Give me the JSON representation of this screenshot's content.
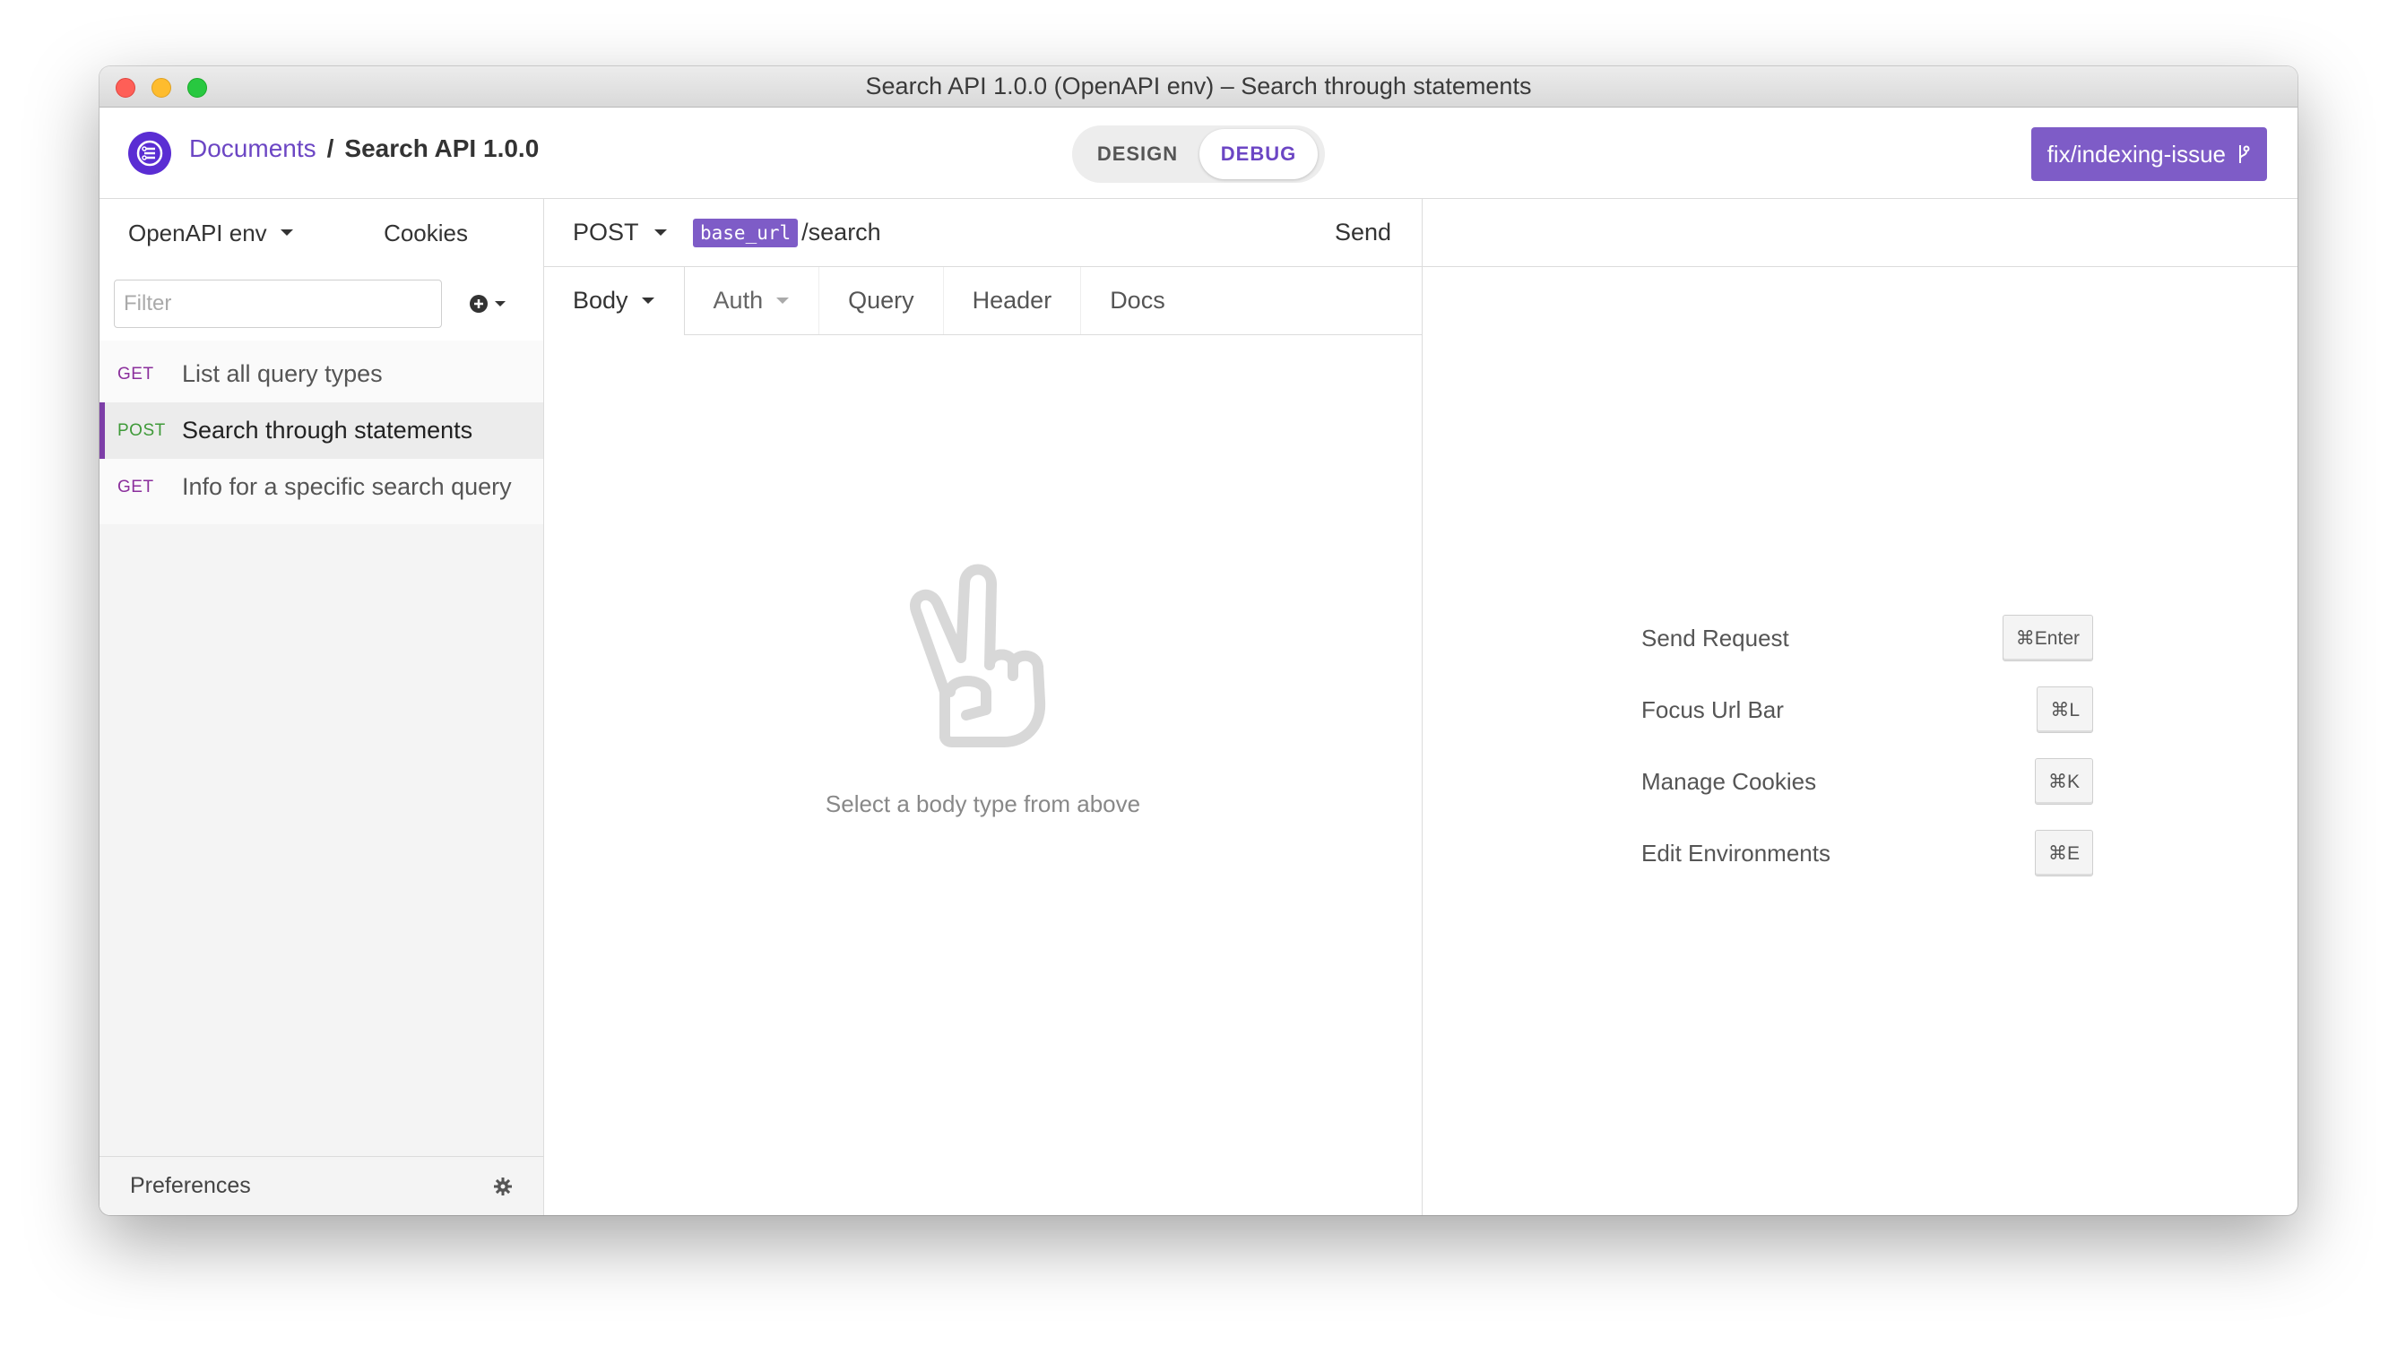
{
  "window": {
    "title": "Search API 1.0.0 (OpenAPI env) – Search through statements"
  },
  "header": {
    "breadcrumb_link": "Documents",
    "breadcrumb_separator": "/",
    "breadcrumb_current": "Search API 1.0.0",
    "mode_design": "DESIGN",
    "mode_debug": "DEBUG",
    "active_mode": "DEBUG",
    "branch_label": "fix/indexing-issue",
    "accent_color": "#7e5cc7"
  },
  "sidebar": {
    "environment": "OpenAPI env",
    "cookies_label": "Cookies",
    "filter_placeholder": "Filter",
    "requests": [
      {
        "method": "GET",
        "label": "List all query types",
        "active": false
      },
      {
        "method": "POST",
        "label": "Search through statements",
        "active": true
      },
      {
        "method": "GET",
        "label": "Info for a specific search query",
        "active": false
      }
    ],
    "preferences_label": "Preferences"
  },
  "request": {
    "method": "POST",
    "url_variable": "base_url",
    "url_path": "/search",
    "send_label": "Send",
    "tabs": [
      {
        "label": "Body",
        "active": true,
        "dropdown": true
      },
      {
        "label": "Auth",
        "active": false,
        "dropdown": true
      },
      {
        "label": "Query",
        "active": false,
        "dropdown": false
      },
      {
        "label": "Header",
        "active": false,
        "dropdown": false
      },
      {
        "label": "Docs",
        "active": false,
        "dropdown": false
      }
    ],
    "empty_message": "Select a body type from above"
  },
  "response": {
    "shortcuts": [
      {
        "label": "Send Request",
        "key": "⌘Enter"
      },
      {
        "label": "Focus Url Bar",
        "key": "⌘L"
      },
      {
        "label": "Manage Cookies",
        "key": "⌘K"
      },
      {
        "label": "Edit Environments",
        "key": "⌘E"
      }
    ]
  }
}
